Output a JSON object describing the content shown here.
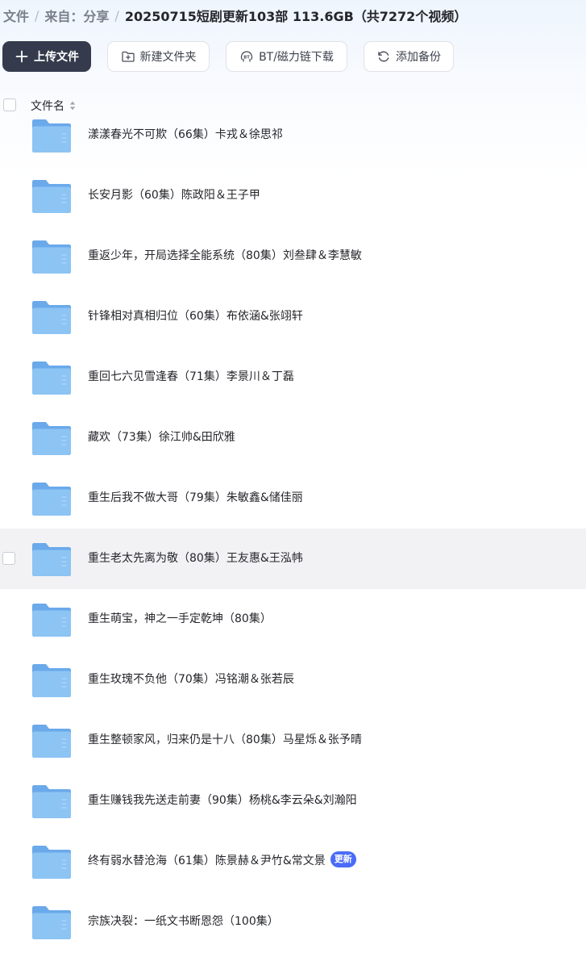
{
  "breadcrumb": {
    "root": "文件",
    "source": "来自：分享",
    "current": "20250715短剧更新103部 113.6GB（共7272个视频）",
    "separator": "/"
  },
  "toolbar": {
    "upload": "上传文件",
    "new_folder": "新建文件夹",
    "bt_download": "BT/磁力链下载",
    "add_backup": "添加备份"
  },
  "list_header": {
    "name_column": "文件名"
  },
  "colors": {
    "primary_button": "#353b4c",
    "folder": "#7fbaf2",
    "badge": "#4a6cf7"
  },
  "files": [
    {
      "name": "漾漾春光不可欺（66集）卡戎＆徐思祁"
    },
    {
      "name": "长安月影（60集）陈政阳＆王子甲"
    },
    {
      "name": "重返少年，开局选择全能系统（80集）刘叁肆＆李慧敏"
    },
    {
      "name": "针锋相对真相归位（60集）布依涵&张翊轩"
    },
    {
      "name": "重回七六见雪逢春（71集）李景川＆丁磊"
    },
    {
      "name": "藏欢（73集）徐江帅&田欣雅"
    },
    {
      "name": "重生后我不做大哥（79集）朱敏鑫&储佳丽"
    },
    {
      "name": "重生老太先离为敬（80集）王友惠&王泓帏"
    },
    {
      "name": "重生萌宝，神之一手定乾坤（80集）"
    },
    {
      "name": "重生玫瑰不负他（70集）冯铭潮＆张若辰"
    },
    {
      "name": "重生整顿家风，归来仍是十八（80集）马星烁＆张予晴"
    },
    {
      "name": "重生赚钱我先送走前妻（90集）杨桃&李云朵&刘瀚阳"
    },
    {
      "name": "终有弱水替沧海（61集）陈景赫＆尹竹&常文景",
      "badge": "更新"
    },
    {
      "name": "宗族决裂：一纸文书断恩怨（100集）"
    }
  ]
}
